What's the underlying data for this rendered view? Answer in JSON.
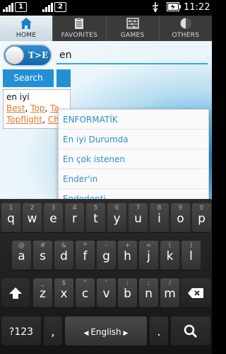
{
  "status_bar": {
    "sim1": "1",
    "sim2": "2",
    "time": "11:22"
  },
  "tabs": [
    {
      "label": "HOME",
      "icon": "home-icon",
      "active": true
    },
    {
      "label": "FAVORITES",
      "icon": "clipboard-icon",
      "active": false
    },
    {
      "label": "GAMES",
      "icon": "abacus-icon",
      "active": false
    },
    {
      "label": "OTHERS",
      "icon": "circle-half-icon",
      "active": false
    }
  ],
  "toggle": {
    "label": "T>E"
  },
  "search": {
    "value": "en",
    "button_label": "Search"
  },
  "result": {
    "word": "en iyi",
    "synonyms_line1": [
      "Best",
      "Top",
      "Ta"
    ],
    "synonyms_line2": [
      "Topflight",
      "Ch"
    ]
  },
  "suggestions": [
    "ENFORMATİK",
    "En iyi Durumda",
    "En çok istenen",
    "Ender'ın",
    "Endodonti"
  ],
  "keyboard": {
    "row1": [
      {
        "k": "q",
        "h": "1"
      },
      {
        "k": "w",
        "h": "2"
      },
      {
        "k": "e",
        "h": "3"
      },
      {
        "k": "r",
        "h": "4"
      },
      {
        "k": "t",
        "h": "5"
      },
      {
        "k": "y",
        "h": "6"
      },
      {
        "k": "u",
        "h": "7"
      },
      {
        "k": "i",
        "h": "8"
      },
      {
        "k": "o",
        "h": "9"
      },
      {
        "k": "p",
        "h": "0"
      }
    ],
    "row2": [
      {
        "k": "a",
        "h": "@"
      },
      {
        "k": "s",
        "h": "#"
      },
      {
        "k": "d",
        "h": "&"
      },
      {
        "k": "f",
        "h": "*"
      },
      {
        "k": "g",
        "h": "-"
      },
      {
        "k": "h",
        "h": "+"
      },
      {
        "k": "j",
        "h": "="
      },
      {
        "k": "k",
        "h": "("
      },
      {
        "k": "l",
        "h": ")"
      }
    ],
    "row3": [
      {
        "k": "z",
        "h": "_"
      },
      {
        "k": "x",
        "h": "$"
      },
      {
        "k": "c",
        "h": "\""
      },
      {
        "k": "v",
        "h": "'"
      },
      {
        "k": "b",
        "h": ":"
      },
      {
        "k": "n",
        "h": ";"
      },
      {
        "k": "m",
        "h": "/"
      }
    ],
    "symbols_label": "?123",
    "comma": ",",
    "space_label": "English",
    "period": ".",
    "accent_color": "#2390d6"
  }
}
